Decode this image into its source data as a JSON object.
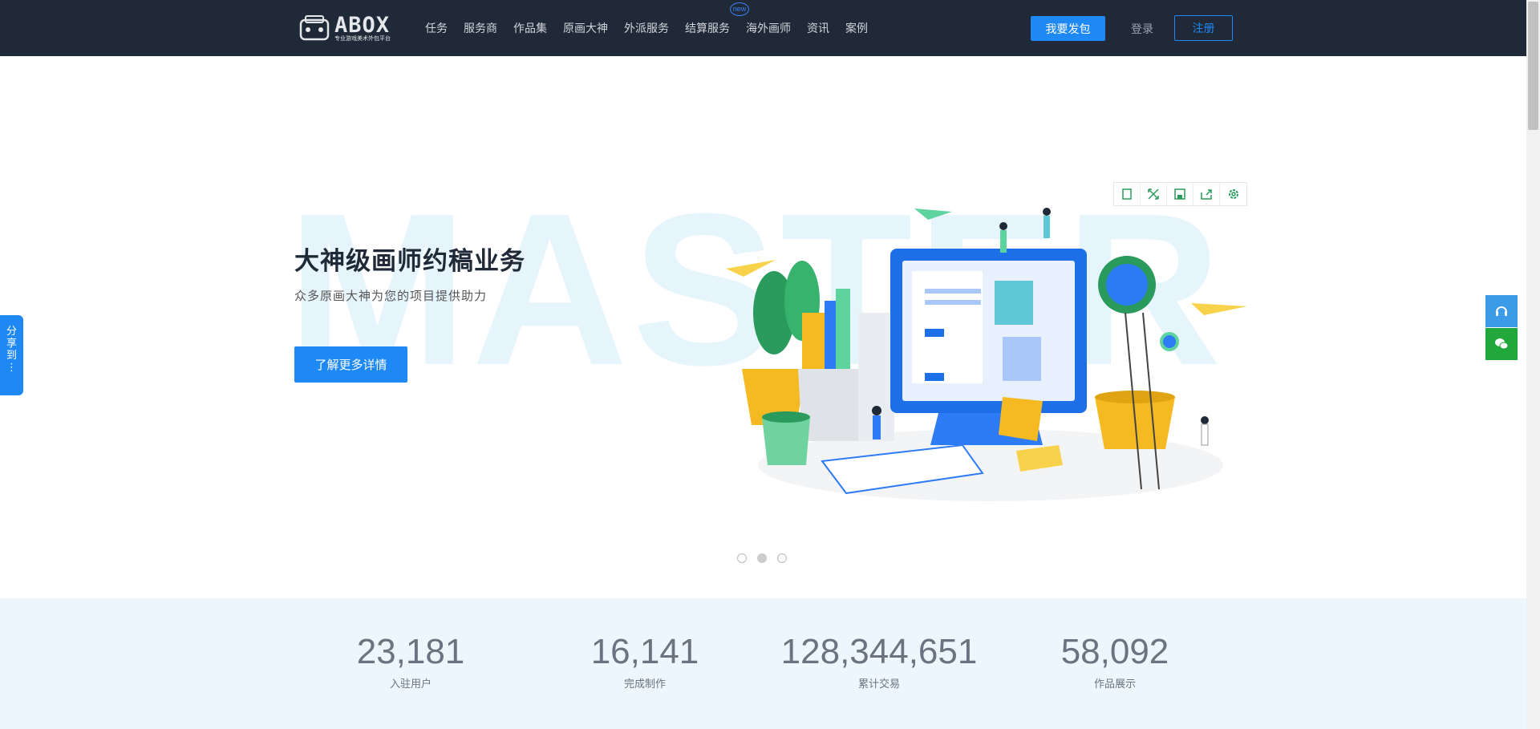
{
  "header": {
    "logo_text": "ABOX",
    "logo_sub": "专业游戏美术外包平台",
    "nav": [
      "任务",
      "服务商",
      "作品集",
      "原画大神",
      "外派服务",
      "结算服务",
      "海外画师",
      "资讯",
      "案例"
    ],
    "new_badge": "new",
    "post_button": "我要发包",
    "login": "登录",
    "register": "注册"
  },
  "hero": {
    "bg_word": "MASTER",
    "title": "大神级画师约稿业务",
    "subtitle": "众多原画大神为您的项目提供助力",
    "cta": "了解更多详情",
    "carousel": {
      "count": 3,
      "active": 2
    }
  },
  "toolbar": {
    "icons": [
      "fullscreen-icon",
      "expand-icon",
      "save-icon",
      "share-icon",
      "settings-icon"
    ]
  },
  "stats": [
    {
      "value": "23,181",
      "label": "入驻用户"
    },
    {
      "value": "16,141",
      "label": "完成制作"
    },
    {
      "value": "128,344,651",
      "label": "累计交易"
    },
    {
      "value": "58,092",
      "label": "作品展示"
    }
  ],
  "share": {
    "label_1": "分",
    "label_2": "享",
    "label_3": "到",
    "label_4": "⋮"
  },
  "colors": {
    "accent": "#1e88f5",
    "header_bg": "#1f2937",
    "stats_bg": "#ecf6fc",
    "wechat": "#22a83a",
    "service": "#3b9be8"
  }
}
